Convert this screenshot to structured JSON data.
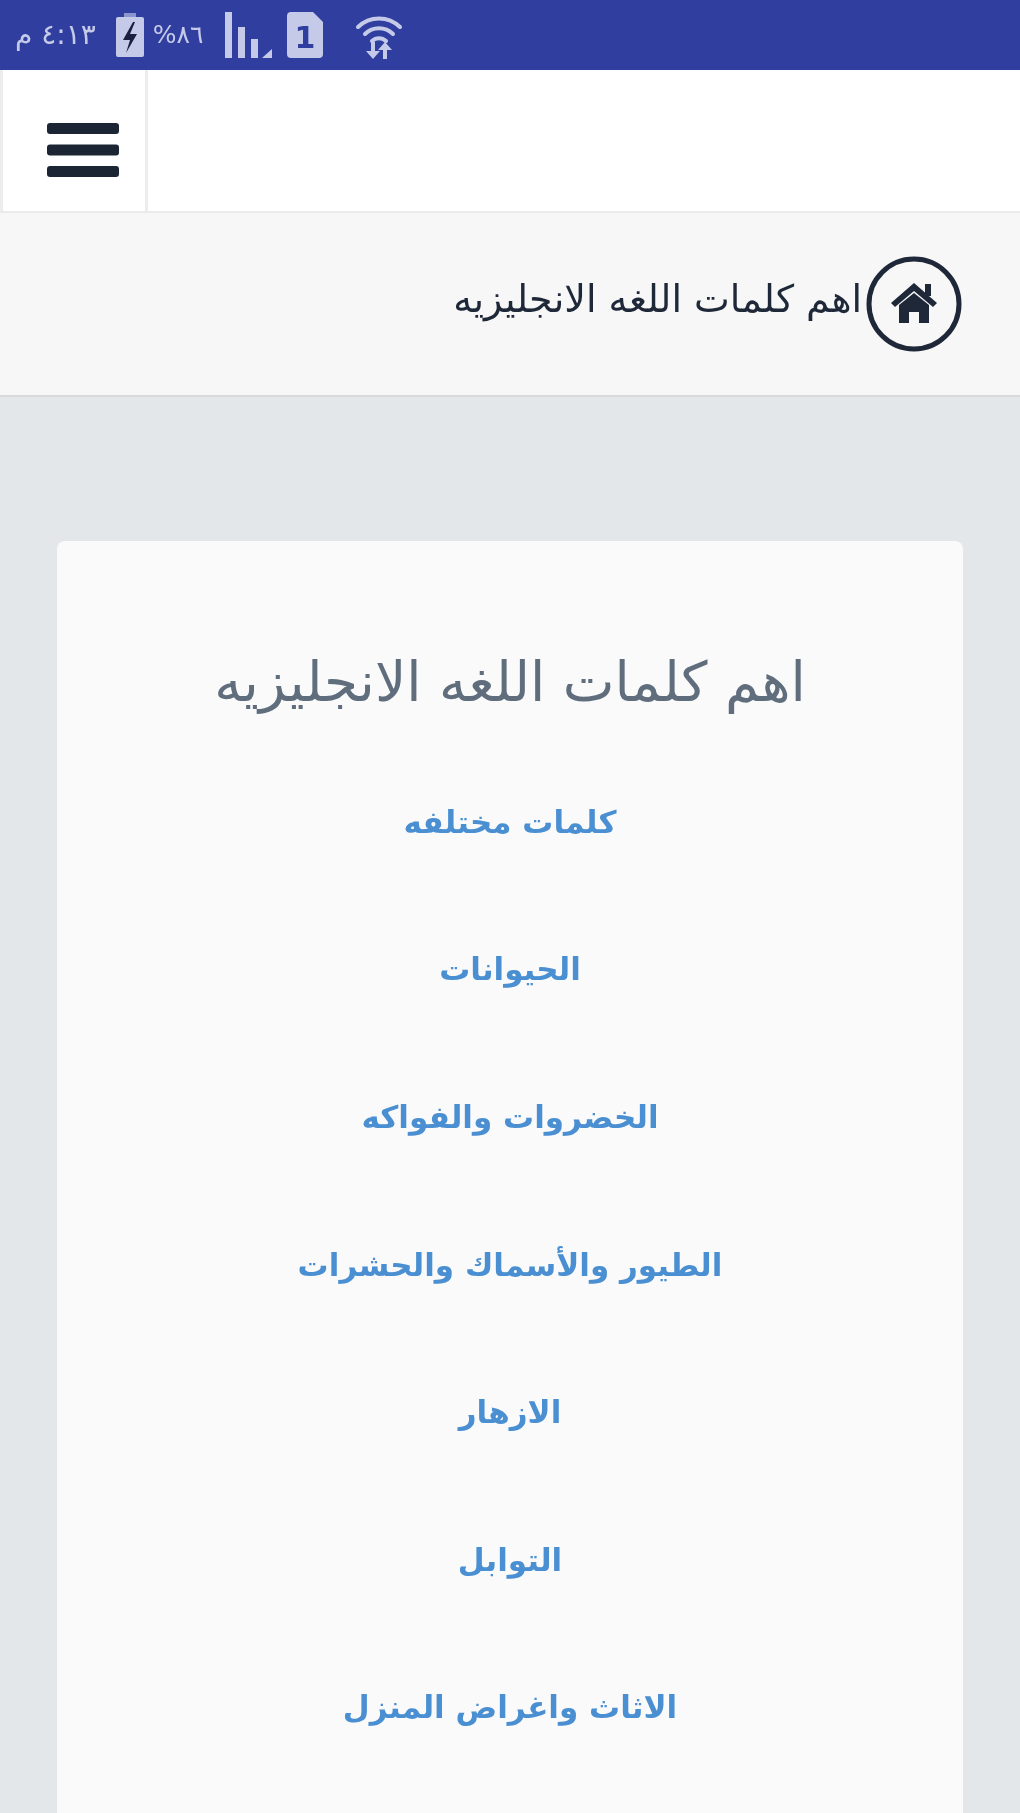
{
  "status_bar": {
    "time": "٤:١٣ م",
    "battery_percent": "%٨٦",
    "sim_slot": "1"
  },
  "breadcrumb": {
    "title": "اهم كلمات اللغه الانجليزيه"
  },
  "card": {
    "title": "اهم كلمات اللغه الانجليزيه",
    "links": [
      "كلمات مختلفه",
      "الحيوانات",
      "الخضروات والفواكه",
      "الطيور والأسماك والحشرات",
      "الازهار",
      "التوابل",
      "الاثاث واغراض المنزل"
    ]
  }
}
